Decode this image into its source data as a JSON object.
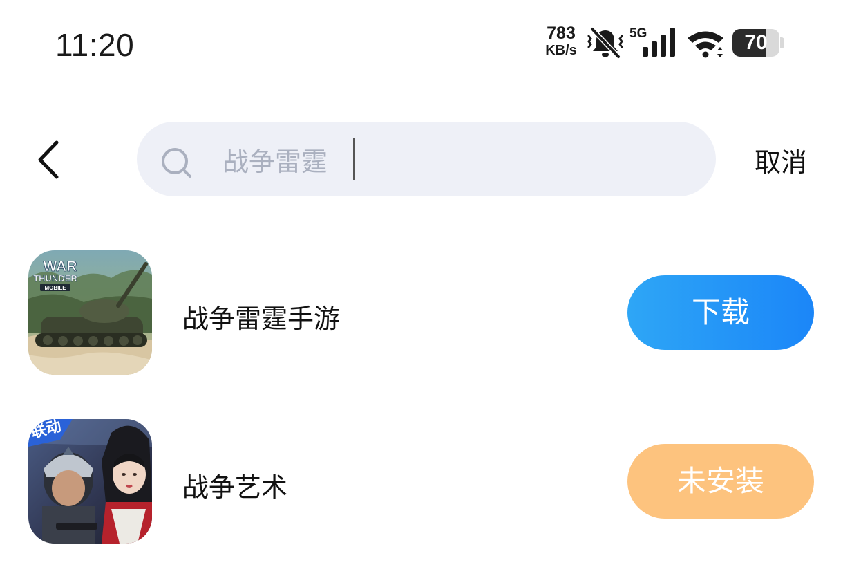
{
  "status_bar": {
    "time": "11:20",
    "net_speed_value": "783",
    "net_speed_unit": "KB/s",
    "network_type": "5G",
    "battery_level": "70",
    "battery_fraction": 0.7
  },
  "search": {
    "query": "战争雷霆",
    "cancel_label": "取消"
  },
  "results": [
    {
      "name": "战争雷霆手游",
      "icon_badge": [
        "WAR",
        "THUNDER",
        "MOBILE"
      ],
      "action_label": "下载",
      "action_color": "#2196F3"
    },
    {
      "name": "战争艺术",
      "icon_badge": [
        "联动"
      ],
      "action_label": "未安装",
      "action_color": "#FDC37E"
    }
  ]
}
